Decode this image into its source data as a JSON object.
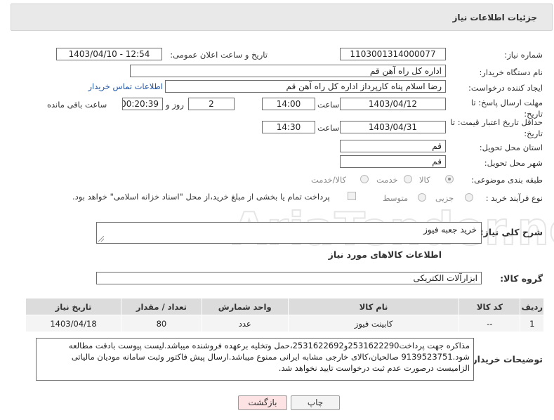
{
  "header": {
    "title": "جزئیات اطلاعات نیاز"
  },
  "fields": {
    "need_number": {
      "label": "شماره نیاز:",
      "value": "1103001314000077"
    },
    "announce": {
      "label": "تاریخ و ساعت اعلان عمومی:",
      "value": "1403/04/10 - 12:54"
    },
    "buyer_org": {
      "label": "نام دستگاه خریدار:",
      "value": "اداره کل  راه آهن قم"
    },
    "creator": {
      "label": "ایجاد کننده درخواست:",
      "value": "رضا اسلام پناه کارپرداز اداره کل  راه آهن قم",
      "contact_link": "اطلاعات تماس خریدار"
    },
    "reply_deadline": {
      "label": "مهلت ارسال پاسخ: تا تاریخ:",
      "date": "1403/04/12",
      "time_label": "ساعت",
      "time": "14:00",
      "days": "2",
      "days_label": "روز و",
      "remaining": "00:20:39",
      "remaining_label": "ساعت باقی مانده"
    },
    "price_validity": {
      "label": "حداقل تاریخ اعتبار قیمت: تا تاریخ:",
      "date": "1403/04/31",
      "time_label": "ساعت",
      "time": "14:30"
    },
    "province": {
      "label": "استان محل تحویل:",
      "value": "قم"
    },
    "city": {
      "label": "شهر محل تحویل:",
      "value": "قم"
    },
    "category": {
      "label": "طبقه بندی موضوعی:",
      "options": [
        "کالا",
        "خدمت",
        "کالا/خدمت"
      ],
      "selected": "کالا"
    },
    "process": {
      "label": "نوع فرآیند خرید :",
      "options": [
        "جزیی",
        "متوسط"
      ],
      "payment_note": "پرداخت تمام یا بخشی از مبلغ خرید،از محل \"اسناد خزانه اسلامی\" خواهد بود."
    },
    "description": {
      "label": "شرح کلی نیاز:",
      "value": "خرید جعبه فیوز"
    }
  },
  "goods_section": {
    "title": "اطلاعات کالاهای مورد نیاز",
    "group_label": "گروه کالا:",
    "group_value": "ابزارآلات الکتریکی",
    "table": {
      "columns": [
        "ردیف",
        "کد کالا",
        "نام کالا",
        "واحد شمارش",
        "تعداد / مقدار",
        "تاریخ نیاز"
      ],
      "rows": [
        [
          "1",
          "--",
          "کابینت فیوز",
          "عدد",
          "80",
          "1403/04/18"
        ]
      ]
    }
  },
  "buyer_notes": {
    "label": "توضیحات خریدار:",
    "text": "مذاکره جهت پرداخت2531622290و2531622692،حمل وتخلیه برعهده فروشنده میباشد.لیست پیوست بادقت مطالعه شود.9139523751 صالحیان،کالای خارجی مشابه ایرانی ممنوع میباشد.ارسال پیش فاکتور وثبت سامانه مودیان مالیاتی الزامیست درصورت عدم ثبت درخواست تایید نخواهد شد."
  },
  "buttons": {
    "print": "چاپ",
    "back": "بازگشت"
  },
  "watermark": {
    "text": "AriaTender.net"
  },
  "colors": {
    "link": "#1f54a8",
    "back_button_bg": "#fde3e3",
    "header_bg": "#e9e9e9"
  }
}
